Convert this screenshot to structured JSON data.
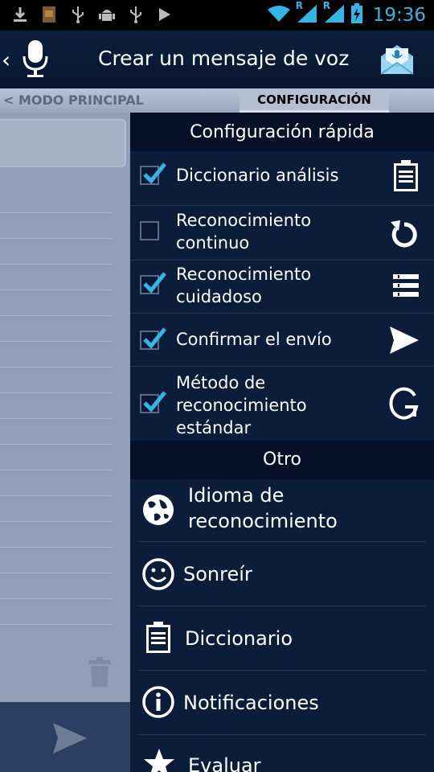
{
  "status_bar": {
    "time": "19:36",
    "icons": [
      "download-icon",
      "image-notification-icon",
      "usb-icon",
      "android-debug-icon",
      "usb-icon",
      "play-icon",
      "wifi-icon",
      "signal-icon",
      "signal-icon",
      "battery-charging-icon"
    ],
    "roaming_indicator": "R"
  },
  "action_bar": {
    "title": "Crear un mensaje de voz",
    "back_glyph": "‹"
  },
  "tabs": {
    "main_label": "< MODO PRINCIPAL",
    "config_label": "CONFIGURACIÓN"
  },
  "drawer": {
    "quick_header": "Configuración rápida",
    "quick_items": [
      {
        "label_line1": "Diccionario análisis",
        "label_line2": "",
        "label_line3": "",
        "checked": true,
        "icon": "clipboard-icon"
      },
      {
        "label_line1": "Reconocimiento",
        "label_line2": "continuo",
        "label_line3": "",
        "checked": false,
        "icon": "refresh-icon"
      },
      {
        "label_line1": "Reconocimiento",
        "label_line2": "cuidadoso",
        "label_line3": "",
        "checked": true,
        "icon": "list-icon"
      },
      {
        "label_line1": "Confirmar el envío",
        "label_line2": "",
        "label_line3": "",
        "checked": true,
        "icon": "send-icon"
      },
      {
        "label_line1": "Método de",
        "label_line2": "reconocimiento",
        "label_line3": "estándar",
        "checked": true,
        "icon": "google-icon"
      }
    ],
    "other_header": "Otro",
    "other_items": [
      {
        "label_line1": "Idioma de",
        "label_line2": "reconocimiento",
        "icon": "globe-icon"
      },
      {
        "label_line1": "Sonreír",
        "label_line2": "",
        "icon": "smiley-icon"
      },
      {
        "label_line1": "Diccionario",
        "label_line2": "",
        "icon": "clipboard-icon"
      },
      {
        "label_line1": "Notificaciones",
        "label_line2": "",
        "icon": "info-icon"
      },
      {
        "label_line1": "Evaluar",
        "label_line2": "",
        "icon": "star-icon"
      }
    ]
  },
  "colors": {
    "accent": "#33b5e5",
    "drawer_bg": "#0c1d3a",
    "header_bg": "#061129",
    "action_bar": "#0b1f3c"
  }
}
